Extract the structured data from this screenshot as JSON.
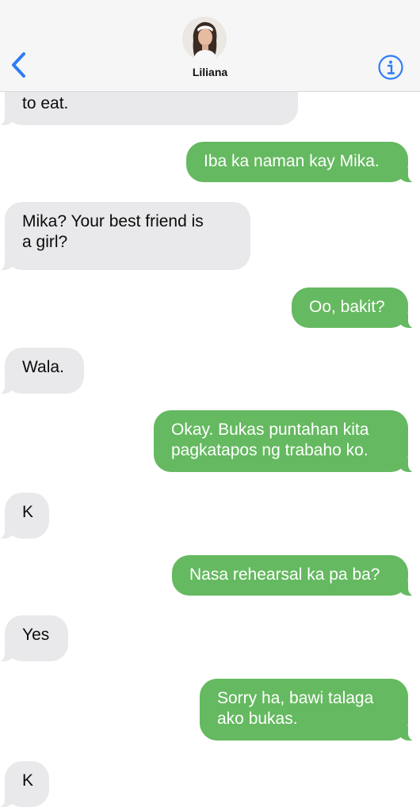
{
  "header": {
    "contact_name": "Liliana",
    "back_icon": "chevron-left-icon",
    "info_icon": "info-circle-icon",
    "accent_color": "#2f7cf6"
  },
  "colors": {
    "incoming_bubble": "#e9e9eb",
    "outgoing_bubble": "#65b960",
    "header_bg": "#f6f6f7"
  },
  "messages": [
    {
      "direction": "incoming",
      "text": "to eat."
    },
    {
      "direction": "outgoing",
      "text": "Iba ka naman kay Mika."
    },
    {
      "direction": "incoming",
      "text": "Mika? Your best friend is\na girl?"
    },
    {
      "direction": "outgoing",
      "text": "Oo, bakit?"
    },
    {
      "direction": "incoming",
      "text": "Wala."
    },
    {
      "direction": "outgoing",
      "text": "Okay. Bukas puntahan kita\npagkatapos ng trabaho ko."
    },
    {
      "direction": "incoming",
      "text": "K"
    },
    {
      "direction": "outgoing",
      "text": "Nasa rehearsal ka pa ba?"
    },
    {
      "direction": "incoming",
      "text": "Yes"
    },
    {
      "direction": "outgoing",
      "text": "Sorry ha, bawi talaga\nako bukas."
    },
    {
      "direction": "incoming",
      "text": "K"
    }
  ]
}
